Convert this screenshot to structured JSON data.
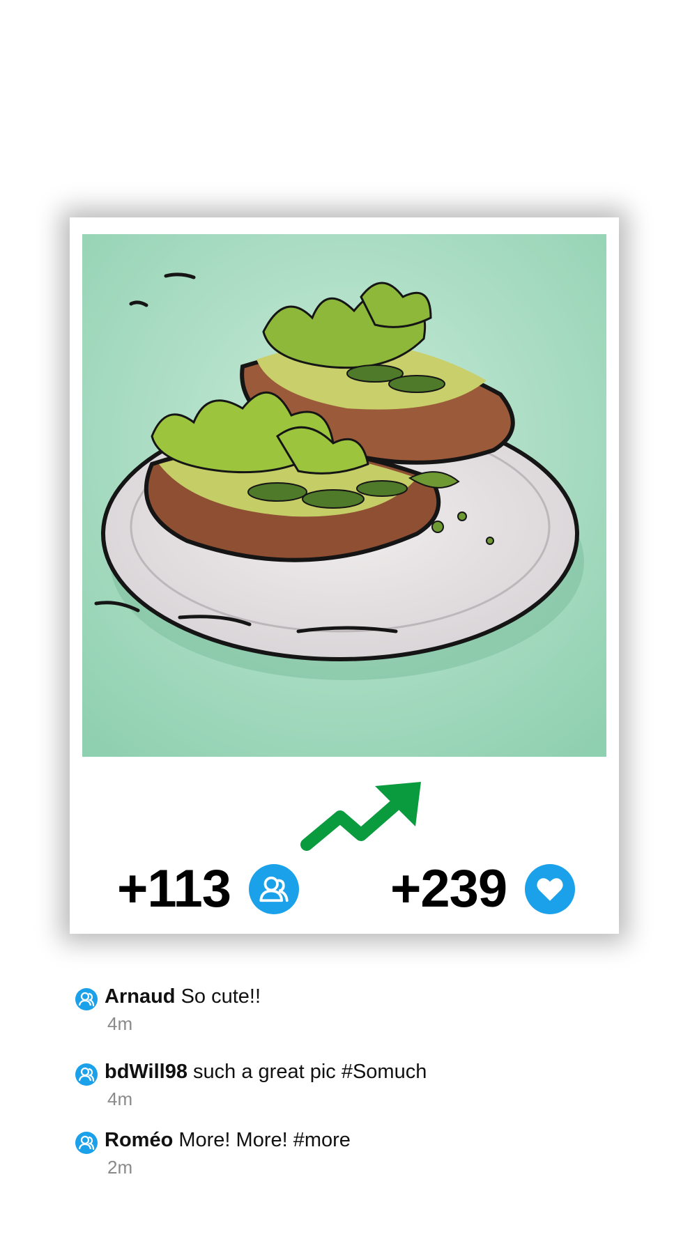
{
  "post": {
    "image_icon": "avocado-toast-illustration",
    "trend_icon": "trending-up-arrow-icon",
    "followers_gain": "+113",
    "followers_icon": "users-icon",
    "likes_gain": "+239",
    "likes_icon": "heart-icon"
  },
  "colors": {
    "accent_blue": "#1ba1ea",
    "trend_green": "#0a9b3e",
    "time_gray": "#8a8a8a"
  },
  "comments": [
    {
      "user": "Arnaud",
      "text": "So cute!!",
      "time": "4m"
    },
    {
      "user": "bdWill98",
      "text": "such a great pic #Somuch",
      "time": "4m"
    },
    {
      "user": "Roméo",
      "text": "More! More! #more",
      "time": "2m"
    }
  ]
}
